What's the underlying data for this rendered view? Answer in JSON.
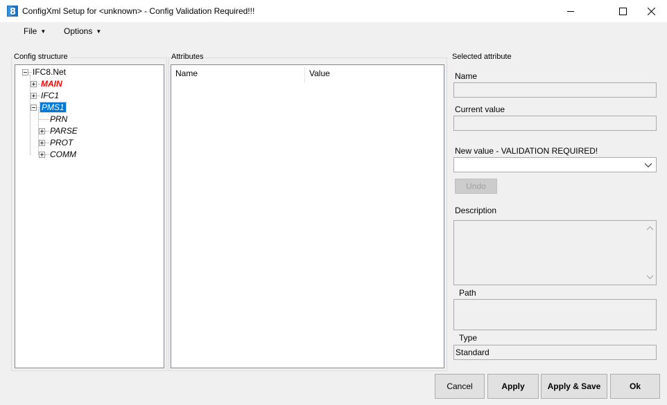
{
  "window": {
    "title": "ConfigXml Setup for <unknown> - Config Validation Required!!!",
    "minimize_glyph": "—",
    "maximize_glyph": "☐",
    "close_glyph": "✕"
  },
  "menu": {
    "file": "File",
    "options": "Options"
  },
  "config_structure": {
    "title": "Config structure",
    "tree": [
      {
        "label": "IFC8.Net",
        "state": "expanded"
      },
      {
        "label": "MAIN",
        "state": "collapsed",
        "color": "#ff0000",
        "style": "bold-italic"
      },
      {
        "label": "IFC1",
        "state": "collapsed",
        "style": "italic"
      },
      {
        "label": "PMS1",
        "state": "expanded",
        "style": "italic",
        "selected": true
      },
      {
        "label": "PRN",
        "state": "leaf",
        "style": "italic"
      },
      {
        "label": "PARSE",
        "state": "collapsed",
        "style": "italic"
      },
      {
        "label": "PROT",
        "state": "collapsed",
        "style": "italic"
      },
      {
        "label": "COMM",
        "state": "collapsed",
        "style": "italic"
      }
    ]
  },
  "attributes": {
    "title": "Attributes",
    "columns": [
      "Name",
      "Value"
    ]
  },
  "selected_attribute": {
    "title": "Selected attribute",
    "name_label": "Name",
    "name_value": "",
    "current_label": "Current value",
    "current_value": "",
    "new_label": "New value - VALIDATION REQUIRED!",
    "new_value": "",
    "undo_label": "Undo",
    "description_label": "Description",
    "description_value": "",
    "path_label": "Path",
    "path_value": "",
    "type_label": "Type",
    "type_value": "Standard"
  },
  "buttons": {
    "cancel": "Cancel",
    "apply": "Apply",
    "apply_save": "Apply & Save",
    "ok": "Ok"
  },
  "colors": {
    "selection": "#0078d7",
    "error_text": "#ff0000"
  }
}
